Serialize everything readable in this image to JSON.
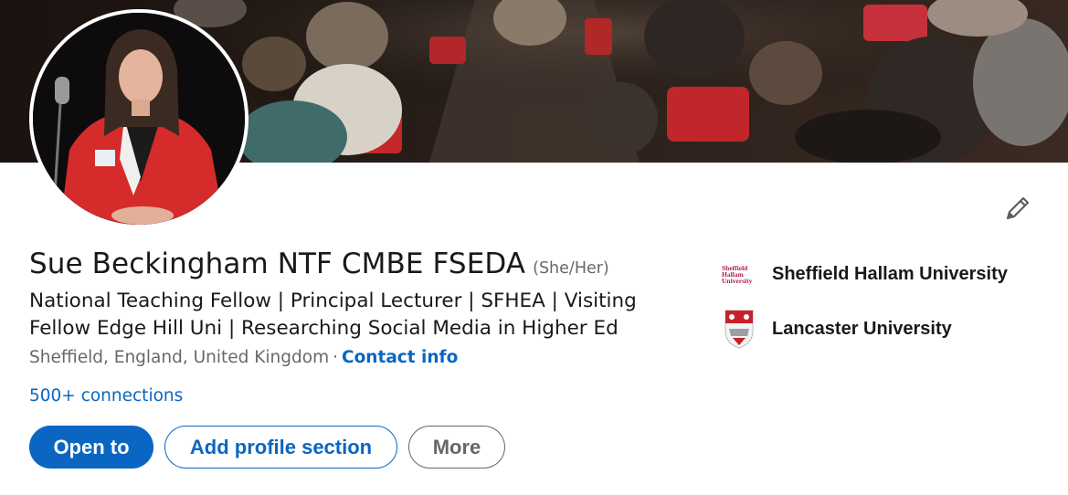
{
  "profile": {
    "name": "Sue Beckingham NTF CMBE FSEDA",
    "pronouns": "(She/Her)",
    "headline": "National Teaching Fellow | Principal Lecturer | SFHEA | Visiting Fellow Edge Hill Uni | Researching Social Media in Higher Ed",
    "location": "Sheffield, England, United Kingdom",
    "separator": "·",
    "contact_info": "Contact info",
    "connections": "500+ connections"
  },
  "actions": {
    "open_to": "Open to",
    "add_section": "Add profile section",
    "more": "More"
  },
  "organizations": [
    {
      "name": "Sheffield Hallam University",
      "logo": "sheffield-hallam-logo",
      "logo_text": [
        "Sheffield",
        "Hallam",
        "University"
      ]
    },
    {
      "name": "Lancaster University",
      "logo": "lancaster-university-crest"
    }
  ],
  "icons": {
    "edit": "pencil-icon"
  },
  "colors": {
    "accent": "#0a66c2",
    "jacket": "#d62b2b",
    "shu_brand": "#b0204f"
  }
}
